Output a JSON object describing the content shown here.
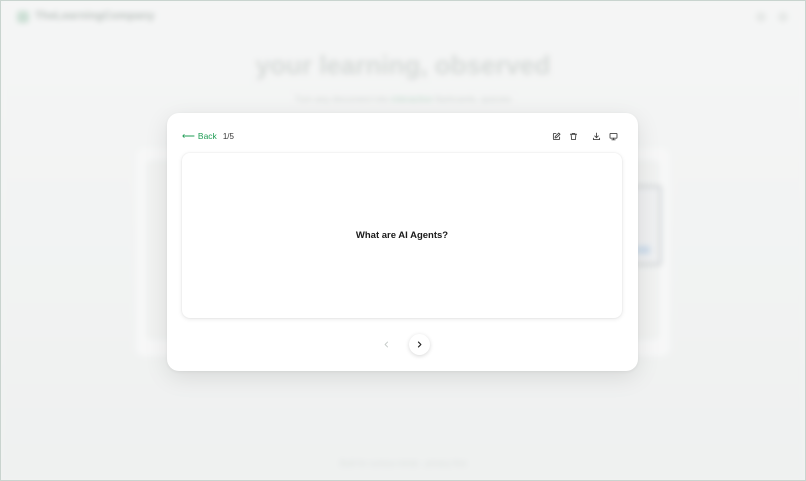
{
  "app": {
    "brand": "TheLearningCompany",
    "hero_title": "your learning, observed",
    "hero_subtitle_a": "Turn any document into",
    "hero_subtitle_accent": "interactive",
    "hero_subtitle_b": "flashcards, quizzes",
    "footer": "Built for curious minds · privacy first"
  },
  "modal": {
    "back_label": "Back",
    "counter": "1/5",
    "toolbar": [
      "edit-icon",
      "trash-icon",
      "download-icon",
      "present-icon"
    ],
    "card": {
      "text": "What are AI Agents?"
    },
    "nav": {
      "prev_icon": "chevron-left-icon",
      "next_icon": "chevron-right-icon"
    },
    "colors": {
      "accent": "#1f9d55",
      "text": "#1a1a1a"
    }
  }
}
